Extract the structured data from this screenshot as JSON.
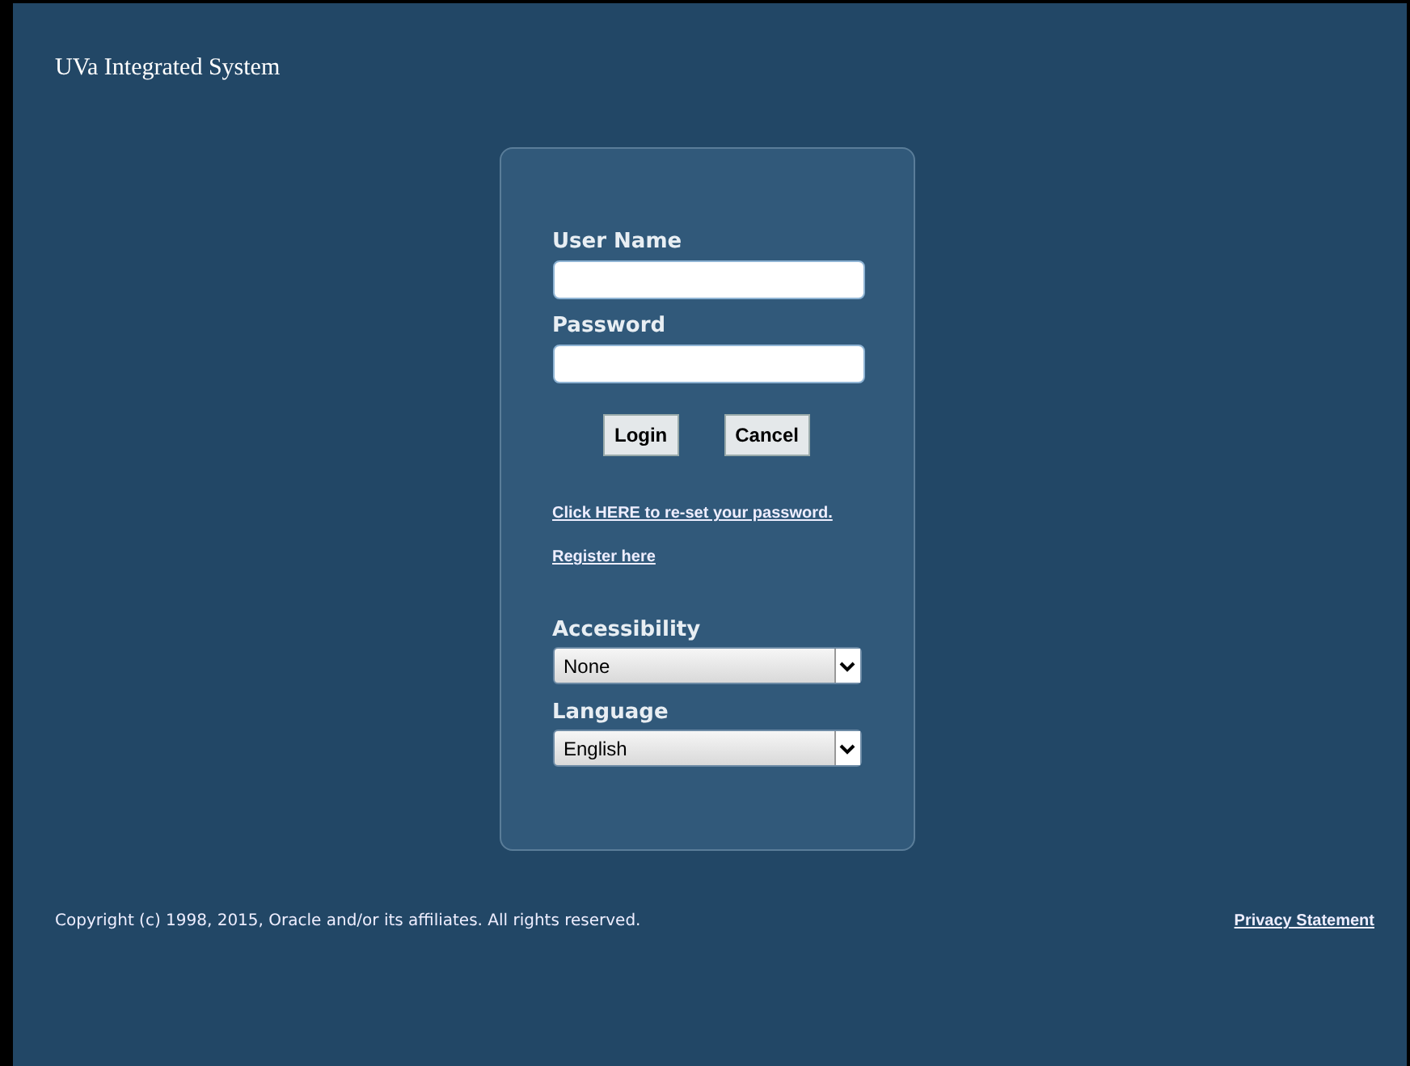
{
  "header": {
    "title": "UVa Integrated System"
  },
  "login": {
    "fields": [
      {
        "label": "User Name"
      },
      {
        "label": "Password"
      }
    ],
    "buttons": [
      "Login",
      "Cancel"
    ],
    "links": [
      "Click HERE to re-set your password.",
      "Register here"
    ],
    "selects": [
      {
        "label": "Accessibility",
        "value": "None"
      },
      {
        "label": "Language",
        "value": "English"
      }
    ]
  },
  "footer": {
    "copyright": "Copyright (c) 1998, 2015, Oracle and/or its affiliates. All rights reserved.",
    "privacy_link": "Privacy Statement"
  }
}
